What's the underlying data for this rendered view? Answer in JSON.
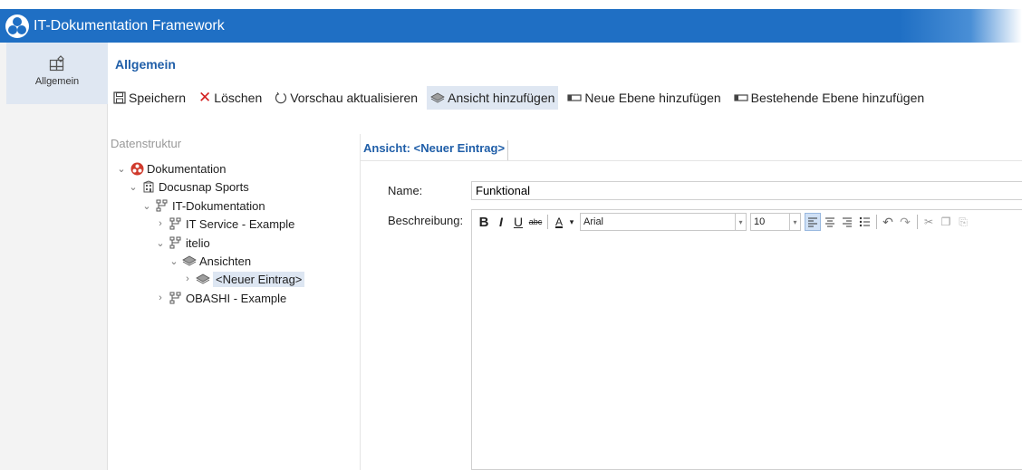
{
  "app": {
    "title": "IT-Dokumentation Framework"
  },
  "sidebar": {
    "items": [
      {
        "label": "Allgemein",
        "icon": "settings-grid-icon"
      }
    ]
  },
  "section": {
    "title": "Allgemein"
  },
  "toolbar": {
    "save": "Speichern",
    "delete": "Löschen",
    "refresh_preview": "Vorschau aktualisieren",
    "add_view": "Ansicht hinzufügen",
    "add_new_layer": "Neue Ebene hinzufügen",
    "add_existing_layer": "Bestehende Ebene hinzufügen"
  },
  "tree": {
    "header": "Datenstruktur",
    "nodes": [
      {
        "label": "Dokumentation",
        "icon": "documentation-icon",
        "expanded": true
      },
      {
        "label": "Docusnap Sports",
        "icon": "building-icon",
        "expanded": true
      },
      {
        "label": "IT-Dokumentation",
        "icon": "hierarchy-icon",
        "expanded": true
      },
      {
        "label": "IT Service - Example",
        "icon": "hierarchy-icon",
        "expanded": false
      },
      {
        "label": "itelio",
        "icon": "hierarchy-icon",
        "expanded": true
      },
      {
        "label": "Ansichten",
        "icon": "view-icon",
        "expanded": true
      },
      {
        "label": "<Neuer Eintrag>",
        "icon": "view-icon",
        "expanded": false,
        "selected": true
      },
      {
        "label": "OBASHI - Example",
        "icon": "hierarchy-icon",
        "expanded": false
      }
    ]
  },
  "detail": {
    "tab": "Ansicht: <Neuer Eintrag>",
    "name_label": "Name:",
    "name_value": "Funktional",
    "description_label": "Beschreibung:",
    "editor": {
      "font": "Arial",
      "size": "10",
      "bold": "B",
      "italic": "I",
      "underline": "U",
      "strike": "abc",
      "font_color": "A"
    }
  },
  "colors": {
    "title_bar": "#1f6fc4",
    "accent_text": "#1f5ea8",
    "selection": "#dfe7f2",
    "delete_red": "#d42020"
  }
}
